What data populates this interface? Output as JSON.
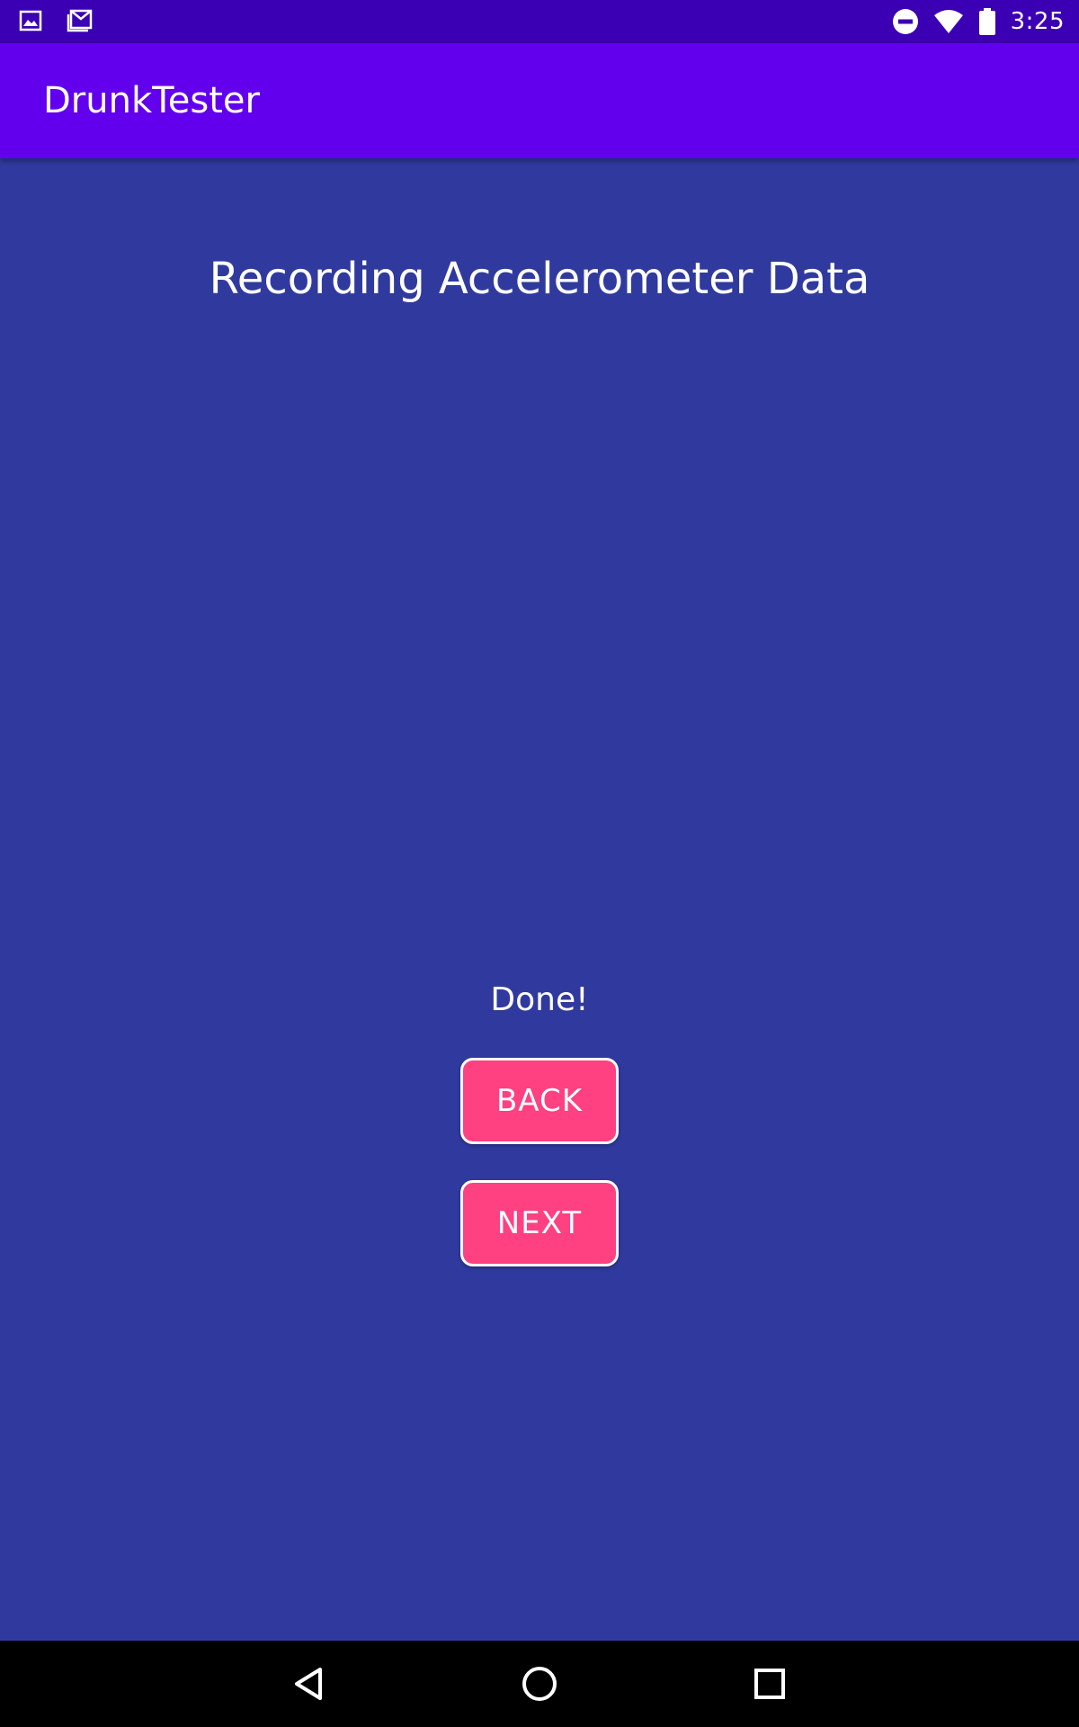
{
  "status_bar": {
    "time": "3:25",
    "left_icons": [
      "image-icon",
      "gmail-icon"
    ],
    "right_icons": [
      "do-not-disturb-icon",
      "wifi-icon",
      "battery-icon"
    ]
  },
  "app_bar": {
    "title": "DrunkTester"
  },
  "main": {
    "heading": "Recording Accelerometer Data",
    "status": "Done!",
    "back_label": "BACK",
    "next_label": "NEXT"
  },
  "nav_bar": {
    "icons": [
      "nav-back-icon",
      "nav-home-icon",
      "nav-recents-icon"
    ]
  },
  "colors": {
    "status_bar": "#3b00b3",
    "app_bar": "#6200ee",
    "background": "#303a9e",
    "button": "#ff4081",
    "nav_bar": "#000000"
  }
}
